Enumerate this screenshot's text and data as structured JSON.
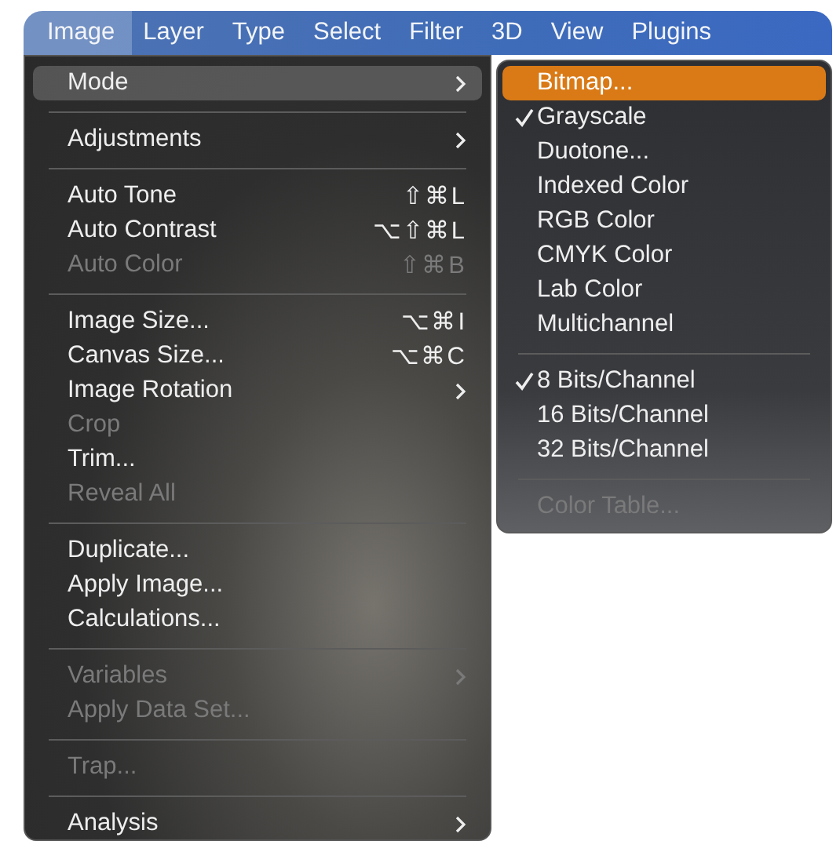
{
  "menubar": [
    {
      "label": "Image",
      "selected": true
    },
    {
      "label": "Layer",
      "selected": false
    },
    {
      "label": "Type",
      "selected": false
    },
    {
      "label": "Select",
      "selected": false
    },
    {
      "label": "Filter",
      "selected": false
    },
    {
      "label": "3D",
      "selected": false
    },
    {
      "label": "View",
      "selected": false
    },
    {
      "label": "Plugins",
      "selected": false
    }
  ],
  "menu": [
    {
      "kind": "item",
      "label": "Mode",
      "submenu": true,
      "selected": true,
      "disabled": false
    },
    {
      "kind": "separator"
    },
    {
      "kind": "item",
      "label": "Adjustments",
      "submenu": true,
      "selected": false,
      "disabled": false
    },
    {
      "kind": "separator"
    },
    {
      "kind": "item",
      "label": "Auto Tone",
      "shortcut": "⇧⌘L",
      "selected": false,
      "disabled": false
    },
    {
      "kind": "item",
      "label": "Auto Contrast",
      "shortcut": "⌥⇧⌘L",
      "selected": false,
      "disabled": false
    },
    {
      "kind": "item",
      "label": "Auto Color",
      "shortcut": "⇧⌘B",
      "selected": false,
      "disabled": true
    },
    {
      "kind": "separator"
    },
    {
      "kind": "item",
      "label": "Image Size...",
      "shortcut": "⌥⌘I",
      "selected": false,
      "disabled": false
    },
    {
      "kind": "item",
      "label": "Canvas Size...",
      "shortcut": "⌥⌘C",
      "selected": false,
      "disabled": false
    },
    {
      "kind": "item",
      "label": "Image Rotation",
      "submenu": true,
      "selected": false,
      "disabled": false
    },
    {
      "kind": "item",
      "label": "Crop",
      "selected": false,
      "disabled": true
    },
    {
      "kind": "item",
      "label": "Trim...",
      "selected": false,
      "disabled": false
    },
    {
      "kind": "item",
      "label": "Reveal All",
      "selected": false,
      "disabled": true
    },
    {
      "kind": "separator"
    },
    {
      "kind": "item",
      "label": "Duplicate...",
      "selected": false,
      "disabled": false
    },
    {
      "kind": "item",
      "label": "Apply Image...",
      "selected": false,
      "disabled": false
    },
    {
      "kind": "item",
      "label": "Calculations...",
      "selected": false,
      "disabled": false
    },
    {
      "kind": "separator"
    },
    {
      "kind": "item",
      "label": "Variables",
      "submenu": true,
      "selected": false,
      "disabled": true
    },
    {
      "kind": "item",
      "label": "Apply Data Set...",
      "selected": false,
      "disabled": true
    },
    {
      "kind": "separator"
    },
    {
      "kind": "item",
      "label": "Trap...",
      "selected": false,
      "disabled": true
    },
    {
      "kind": "separator"
    },
    {
      "kind": "item",
      "label": "Analysis",
      "submenu": true,
      "selected": false,
      "disabled": false
    }
  ],
  "submenu": [
    {
      "kind": "item",
      "label": "Bitmap...",
      "checked": false,
      "selected": true,
      "disabled": false
    },
    {
      "kind": "item",
      "label": "Grayscale",
      "checked": true,
      "selected": false,
      "disabled": false
    },
    {
      "kind": "item",
      "label": "Duotone...",
      "checked": false,
      "selected": false,
      "disabled": false
    },
    {
      "kind": "item",
      "label": "Indexed Color",
      "checked": false,
      "selected": false,
      "disabled": false
    },
    {
      "kind": "item",
      "label": "RGB Color",
      "checked": false,
      "selected": false,
      "disabled": false
    },
    {
      "kind": "item",
      "label": "CMYK Color",
      "checked": false,
      "selected": false,
      "disabled": false
    },
    {
      "kind": "item",
      "label": "Lab Color",
      "checked": false,
      "selected": false,
      "disabled": false
    },
    {
      "kind": "item",
      "label": "Multichannel",
      "checked": false,
      "selected": false,
      "disabled": false
    },
    {
      "kind": "separator"
    },
    {
      "kind": "item",
      "label": "8 Bits/Channel",
      "checked": true,
      "selected": false,
      "disabled": false
    },
    {
      "kind": "item",
      "label": "16 Bits/Channel",
      "checked": false,
      "selected": false,
      "disabled": false
    },
    {
      "kind": "item",
      "label": "32 Bits/Channel",
      "checked": false,
      "selected": false,
      "disabled": false
    },
    {
      "kind": "separator"
    },
    {
      "kind": "item",
      "label": "Color Table...",
      "checked": false,
      "selected": false,
      "disabled": true
    }
  ]
}
